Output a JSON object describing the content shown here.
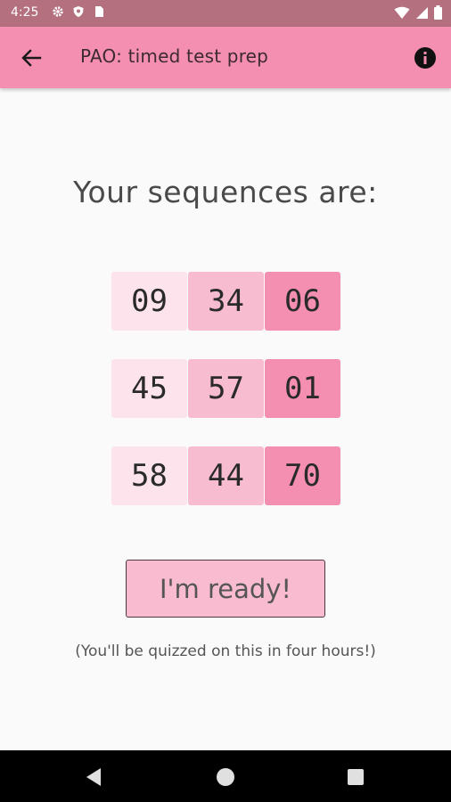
{
  "status_bar": {
    "time": "4:25",
    "icons_left": [
      "settings-icon",
      "shield-icon",
      "sim-icon"
    ],
    "icons_right": [
      "wifi-icon",
      "signal-icon",
      "battery-icon"
    ]
  },
  "app_bar": {
    "title": "PAO: timed test prep",
    "back_icon": "arrow-back-icon",
    "info_icon": "info-icon",
    "color": "#f48fb1"
  },
  "main": {
    "heading": "Your sequences are:",
    "sequences": [
      [
        "09",
        "34",
        "06"
      ],
      [
        "45",
        "57",
        "01"
      ],
      [
        "58",
        "44",
        "70"
      ]
    ],
    "ready_button": "I'm ready!",
    "note": "(You'll be quizzed on this in four hours!)"
  },
  "nav_bar": {
    "back": "nav-back-icon",
    "home": "nav-home-icon",
    "recents": "nav-recents-icon"
  }
}
